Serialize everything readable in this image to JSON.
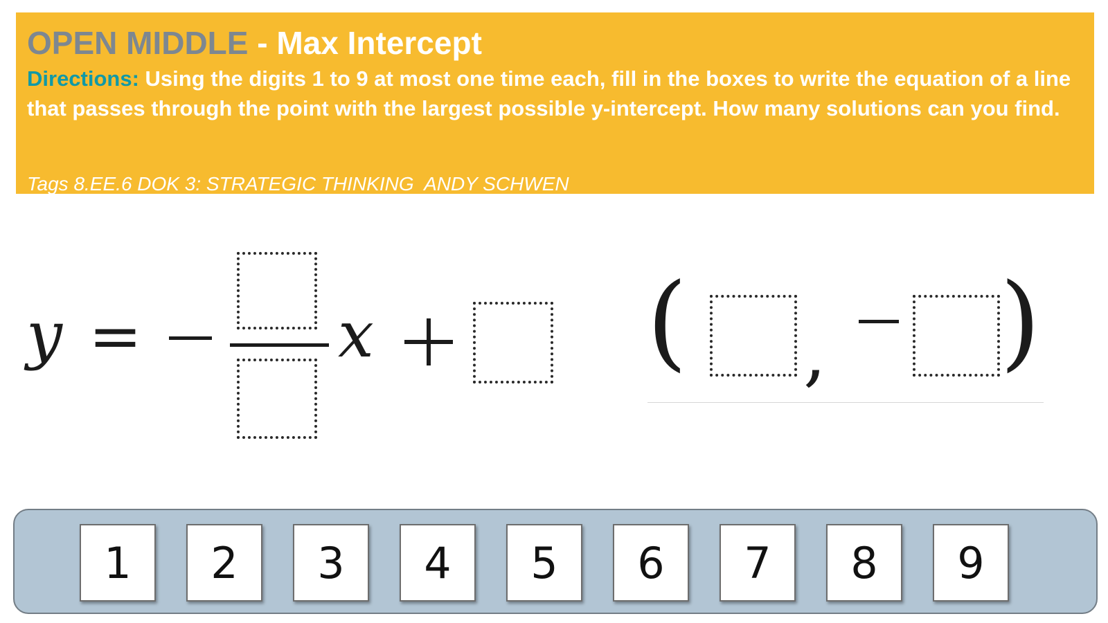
{
  "header": {
    "title_prefix": "OPEN MIDDLE",
    "title_separator": " - ",
    "title_main": "Max Intercept",
    "directions_label": "Directions:",
    "directions_text": " Using the digits 1 to 9 at most one time each, fill in the boxes to write the equation of a line that passes through the point with the largest possible y-intercept. How many solutions can you find.",
    "tags": "Tags 8.EE.6 DOK 3: STRATEGIC THINKING  ANDY SCHWEN"
  },
  "equation": {
    "y": "y",
    "equals": "=",
    "x": "x",
    "open_paren": "(",
    "comma": ",",
    "close_paren": ")"
  },
  "tray": {
    "digits": [
      "1",
      "2",
      "3",
      "4",
      "5",
      "6",
      "7",
      "8",
      "9"
    ]
  },
  "colors": {
    "banner": "#f7bb2f",
    "title_prefix": "#7d8791",
    "directions_label": "#1199a6",
    "tray": "#b2c5d4"
  }
}
